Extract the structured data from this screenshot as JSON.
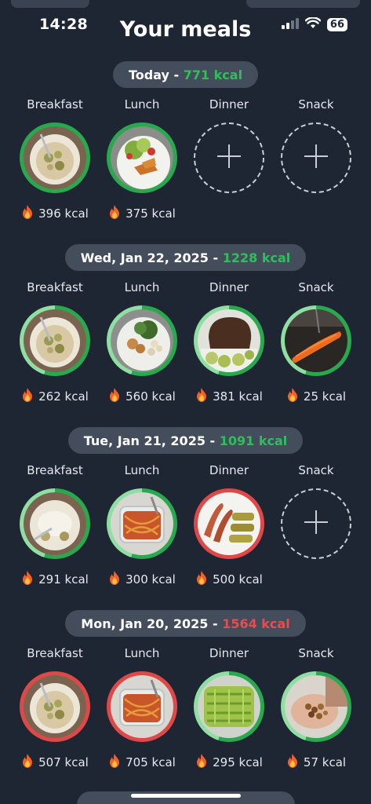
{
  "status": {
    "time": "14:28",
    "battery": "66"
  },
  "title": "Your meals",
  "days": [
    {
      "label": "Today - ",
      "kcal": "771 kcal",
      "kcal_status": "good",
      "meals": [
        {
          "label": "Breakfast",
          "kcal": "396 kcal",
          "ring": "green",
          "photo": "oats"
        },
        {
          "label": "Lunch",
          "kcal": "375 kcal",
          "ring": "green",
          "photo": "salad"
        },
        {
          "label": "Dinner",
          "add": true
        },
        {
          "label": "Snack",
          "add": true
        }
      ]
    },
    {
      "label": "Wed, Jan 22, 2025 - ",
      "kcal": "1228 kcal",
      "kcal_status": "good",
      "meals": [
        {
          "label": "Breakfast",
          "kcal": "262 kcal",
          "ring": "light",
          "photo": "oats"
        },
        {
          "label": "Lunch",
          "kcal": "560 kcal",
          "ring": "light",
          "photo": "chicken"
        },
        {
          "label": "Dinner",
          "kcal": "381 kcal",
          "ring": "light",
          "photo": "bread"
        },
        {
          "label": "Snack",
          "kcal": "25 kcal",
          "ring": "light",
          "photo": "carrot"
        }
      ]
    },
    {
      "label": "Tue, Jan 21, 2025 - ",
      "kcal": "1091 kcal",
      "kcal_status": "good",
      "meals": [
        {
          "label": "Breakfast",
          "kcal": "291 kcal",
          "ring": "light",
          "photo": "yogurt"
        },
        {
          "label": "Lunch",
          "kcal": "300 kcal",
          "ring": "light",
          "photo": "pasta"
        },
        {
          "label": "Dinner",
          "kcal": "500 kcal",
          "ring": "red",
          "photo": "sausage"
        },
        {
          "label": "Snack",
          "add": true
        }
      ]
    },
    {
      "label": "Mon, Jan 20, 2025 - ",
      "kcal": "1564 kcal",
      "kcal_status": "bad",
      "meals": [
        {
          "label": "Breakfast",
          "kcal": "507 kcal",
          "ring": "red",
          "photo": "oats"
        },
        {
          "label": "Lunch",
          "kcal": "705 kcal",
          "ring": "red",
          "photo": "pasta"
        },
        {
          "label": "Dinner",
          "kcal": "295 kcal",
          "ring": "light",
          "photo": "greens"
        },
        {
          "label": "Snack",
          "kcal": "57 kcal",
          "ring": "light",
          "photo": "nuts"
        }
      ]
    }
  ],
  "colors": {
    "background": "#1e2634",
    "pill": "#444d5c",
    "good": "#2fbf5a",
    "bad": "#e84c4c"
  }
}
